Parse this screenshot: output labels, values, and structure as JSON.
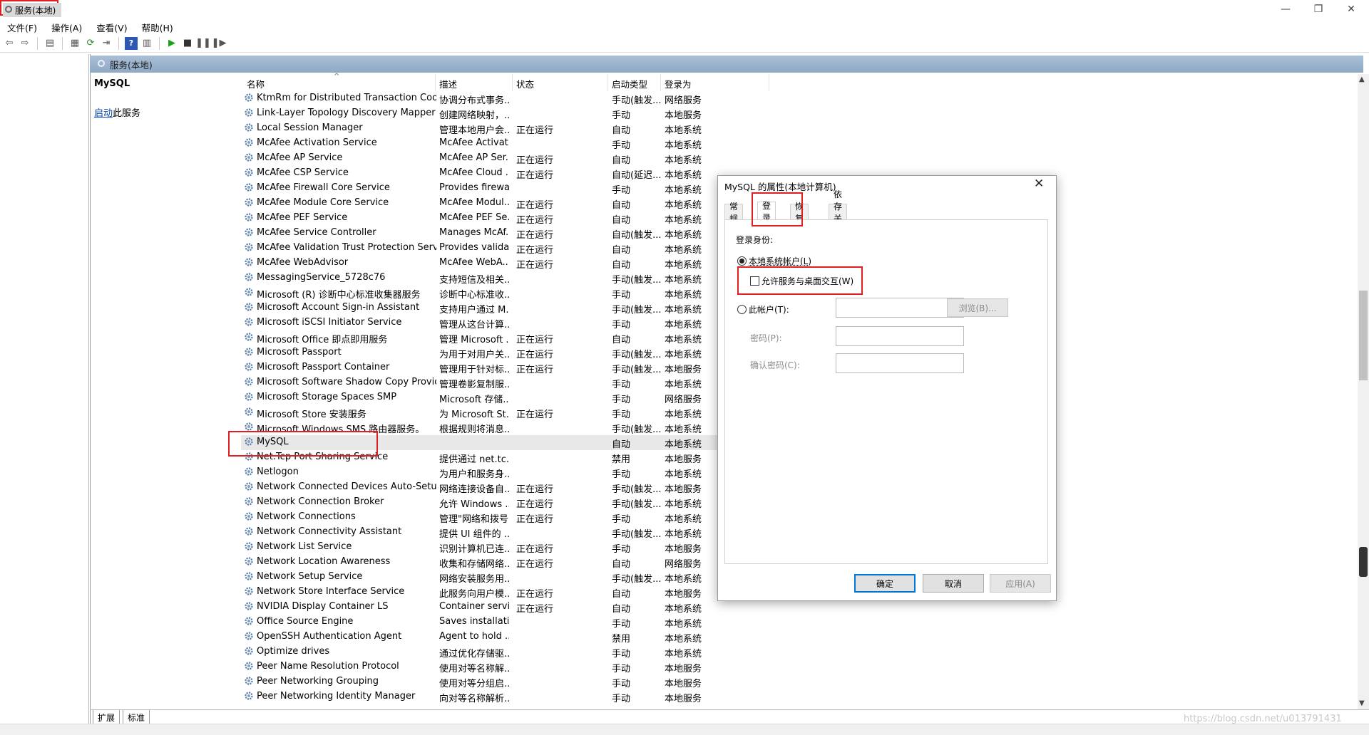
{
  "window": {
    "title": "服务"
  },
  "menu": [
    "文件(F)",
    "操作(A)",
    "查看(V)",
    "帮助(H)"
  ],
  "tree": {
    "root_label": "服务(本地)"
  },
  "main": {
    "header": "服务(本地)",
    "detail": {
      "service_name": "MySQL",
      "start_link": "启动",
      "start_suffix": "此服务"
    }
  },
  "columns": {
    "name": "名称",
    "description": "描述",
    "status": "状态",
    "startup": "启动类型",
    "logon": "登录为"
  },
  "services": [
    {
      "name": "KtmRm for Distributed Transaction Coor...",
      "desc": "协调分布式事务...",
      "status": "",
      "startup": "手动(触发...",
      "logon": "网络服务"
    },
    {
      "name": "Link-Layer Topology Discovery Mapper",
      "desc": "创建网络映射，...",
      "status": "",
      "startup": "手动",
      "logon": "本地服务"
    },
    {
      "name": "Local Session Manager",
      "desc": "管理本地用户会...",
      "status": "正在运行",
      "startup": "自动",
      "logon": "本地系统"
    },
    {
      "name": "McAfee Activation Service",
      "desc": "McAfee Activati...",
      "status": "",
      "startup": "手动",
      "logon": "本地系统"
    },
    {
      "name": "McAfee AP Service",
      "desc": "McAfee AP Ser...",
      "status": "正在运行",
      "startup": "自动",
      "logon": "本地系统"
    },
    {
      "name": "McAfee CSP Service",
      "desc": "McAfee Cloud ...",
      "status": "正在运行",
      "startup": "自动(延迟...",
      "logon": "本地系统"
    },
    {
      "name": "McAfee Firewall Core Service",
      "desc": "Provides firewa...",
      "status": "",
      "startup": "手动",
      "logon": "本地系统"
    },
    {
      "name": "McAfee Module Core Service",
      "desc": "McAfee Modul...",
      "status": "正在运行",
      "startup": "自动",
      "logon": "本地系统"
    },
    {
      "name": "McAfee PEF Service",
      "desc": "McAfee PEF Se...",
      "status": "正在运行",
      "startup": "自动",
      "logon": "本地系统"
    },
    {
      "name": "McAfee Service Controller",
      "desc": "Manages McAf...",
      "status": "正在运行",
      "startup": "自动(触发...",
      "logon": "本地系统"
    },
    {
      "name": "McAfee Validation Trust Protection Servi...",
      "desc": "Provides valida...",
      "status": "正在运行",
      "startup": "自动",
      "logon": "本地系统"
    },
    {
      "name": "McAfee WebAdvisor",
      "desc": "McAfee WebA...",
      "status": "正在运行",
      "startup": "自动",
      "logon": "本地系统"
    },
    {
      "name": "MessagingService_5728c76",
      "desc": "支持短信及相关...",
      "status": "",
      "startup": "手动(触发...",
      "logon": "本地系统"
    },
    {
      "name": "Microsoft (R) 诊断中心标准收集器服务",
      "desc": "诊断中心标准收...",
      "status": "",
      "startup": "手动",
      "logon": "本地系统"
    },
    {
      "name": "Microsoft Account Sign-in Assistant",
      "desc": "支持用户通过 M...",
      "status": "",
      "startup": "手动(触发...",
      "logon": "本地系统"
    },
    {
      "name": "Microsoft iSCSI Initiator Service",
      "desc": "管理从这台计算...",
      "status": "",
      "startup": "手动",
      "logon": "本地系统"
    },
    {
      "name": "Microsoft Office 即点即用服务",
      "desc": "管理 Microsoft ...",
      "status": "正在运行",
      "startup": "自动",
      "logon": "本地系统"
    },
    {
      "name": "Microsoft Passport",
      "desc": "为用于对用户关...",
      "status": "正在运行",
      "startup": "手动(触发...",
      "logon": "本地系统"
    },
    {
      "name": "Microsoft Passport Container",
      "desc": "管理用于针对标...",
      "status": "正在运行",
      "startup": "手动(触发...",
      "logon": "本地服务"
    },
    {
      "name": "Microsoft Software Shadow Copy Provid...",
      "desc": "管理卷影复制服...",
      "status": "",
      "startup": "手动",
      "logon": "本地系统"
    },
    {
      "name": "Microsoft Storage Spaces SMP",
      "desc": "Microsoft 存储...",
      "status": "",
      "startup": "手动",
      "logon": "网络服务"
    },
    {
      "name": "Microsoft Store 安装服务",
      "desc": "为 Microsoft St...",
      "status": "正在运行",
      "startup": "手动",
      "logon": "本地系统"
    },
    {
      "name": "Microsoft Windows SMS 路由器服务。",
      "desc": "根据规则将消息...",
      "status": "",
      "startup": "手动(触发...",
      "logon": "本地系统"
    },
    {
      "name": "MySQL",
      "desc": "",
      "status": "",
      "startup": "自动",
      "logon": "本地系统"
    },
    {
      "name": "Net.Tcp Port Sharing Service",
      "desc": "提供通过 net.tc...",
      "status": "",
      "startup": "禁用",
      "logon": "本地服务"
    },
    {
      "name": "Netlogon",
      "desc": "为用户和服务身...",
      "status": "",
      "startup": "手动",
      "logon": "本地系统"
    },
    {
      "name": "Network Connected Devices Auto-Setup",
      "desc": "网络连接设备自...",
      "status": "正在运行",
      "startup": "手动(触发...",
      "logon": "本地服务"
    },
    {
      "name": "Network Connection Broker",
      "desc": "允许 Windows ...",
      "status": "正在运行",
      "startup": "手动(触发...",
      "logon": "本地系统"
    },
    {
      "name": "Network Connections",
      "desc": "管理\"网络和拨号...",
      "status": "正在运行",
      "startup": "手动",
      "logon": "本地系统"
    },
    {
      "name": "Network Connectivity Assistant",
      "desc": "提供 UI 组件的 ...",
      "status": "",
      "startup": "手动(触发...",
      "logon": "本地系统"
    },
    {
      "name": "Network List Service",
      "desc": "识别计算机已连...",
      "status": "正在运行",
      "startup": "手动",
      "logon": "本地服务"
    },
    {
      "name": "Network Location Awareness",
      "desc": "收集和存储网络...",
      "status": "正在运行",
      "startup": "自动",
      "logon": "网络服务"
    },
    {
      "name": "Network Setup Service",
      "desc": "网络安装服务用...",
      "status": "",
      "startup": "手动(触发...",
      "logon": "本地系统"
    },
    {
      "name": "Network Store Interface Service",
      "desc": "此服务向用户模...",
      "status": "正在运行",
      "startup": "自动",
      "logon": "本地服务"
    },
    {
      "name": "NVIDIA Display Container LS",
      "desc": "Container servi...",
      "status": "正在运行",
      "startup": "自动",
      "logon": "本地系统"
    },
    {
      "name": "Office  Source Engine",
      "desc": "Saves installati...",
      "status": "",
      "startup": "手动",
      "logon": "本地系统"
    },
    {
      "name": "OpenSSH Authentication Agent",
      "desc": "Agent to hold ...",
      "status": "",
      "startup": "禁用",
      "logon": "本地系统"
    },
    {
      "name": "Optimize drives",
      "desc": "通过优化存储驱...",
      "status": "",
      "startup": "手动",
      "logon": "本地系统"
    },
    {
      "name": "Peer Name Resolution Protocol",
      "desc": "使用对等名称解...",
      "status": "",
      "startup": "手动",
      "logon": "本地服务"
    },
    {
      "name": "Peer Networking Grouping",
      "desc": "使用对等分组启...",
      "status": "",
      "startup": "手动",
      "logon": "本地服务"
    },
    {
      "name": "Peer Networking Identity Manager",
      "desc": "向对等名称解析...",
      "status": "",
      "startup": "手动",
      "logon": "本地服务"
    }
  ],
  "bottom_tabs": [
    "扩展",
    "标准"
  ],
  "watermark": "https://blog.csdn.net/u013791431",
  "dialog": {
    "title": "MySQL 的属性(本地计算机)",
    "tabs": [
      "常规",
      "登录",
      "恢复",
      "依存关系"
    ],
    "active_tab": "登录",
    "logon_as_label": "登录身份:",
    "local_system": "本地系统帐户(L)",
    "allow_desktop": "允许服务与桌面交互(W)",
    "this_account": "此帐户(T):",
    "password": "密码(P):",
    "confirm_password": "确认密码(C):",
    "browse": "浏览(B)...",
    "ok": "确定",
    "cancel": "取消",
    "apply": "应用(A)"
  },
  "colors": {
    "highlight": "#e02020",
    "header": "#9bb3cc",
    "primary_button_border": "#0078d7"
  }
}
